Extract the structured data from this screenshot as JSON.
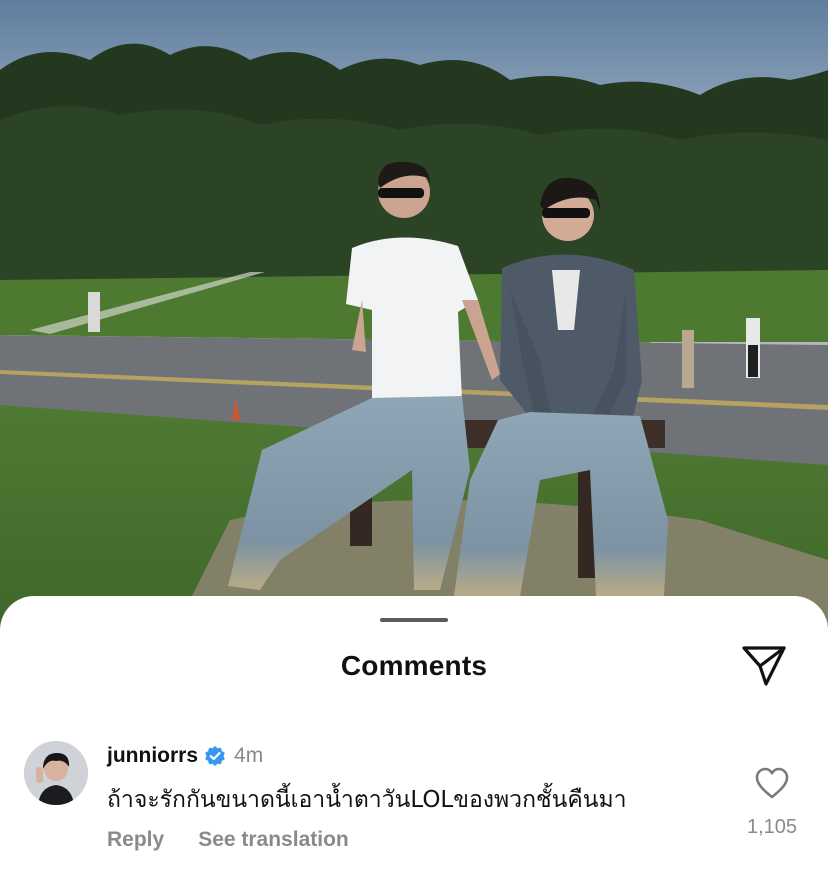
{
  "post": {
    "image_alt": "Two men in sunglasses sitting on a bench by a road with trees behind"
  },
  "comments_sheet": {
    "title": "Comments",
    "share_icon": "paper-plane-icon"
  },
  "comment": {
    "username": "junniorrs",
    "verified": true,
    "time": "4m",
    "text": "ถ้าจะรักกันขนาดนี้เอาน้ำตาวันLOLของพวกชั้นคืนมา",
    "reply_label": "Reply",
    "translate_label": "See translation",
    "like_count": "1,105",
    "like_icon": "heart-outline-icon",
    "verified_icon": "verified-badge-icon"
  },
  "colors": {
    "verified_blue": "#3797f0",
    "muted_text": "#8a8a8a",
    "primary_text": "#111111"
  }
}
